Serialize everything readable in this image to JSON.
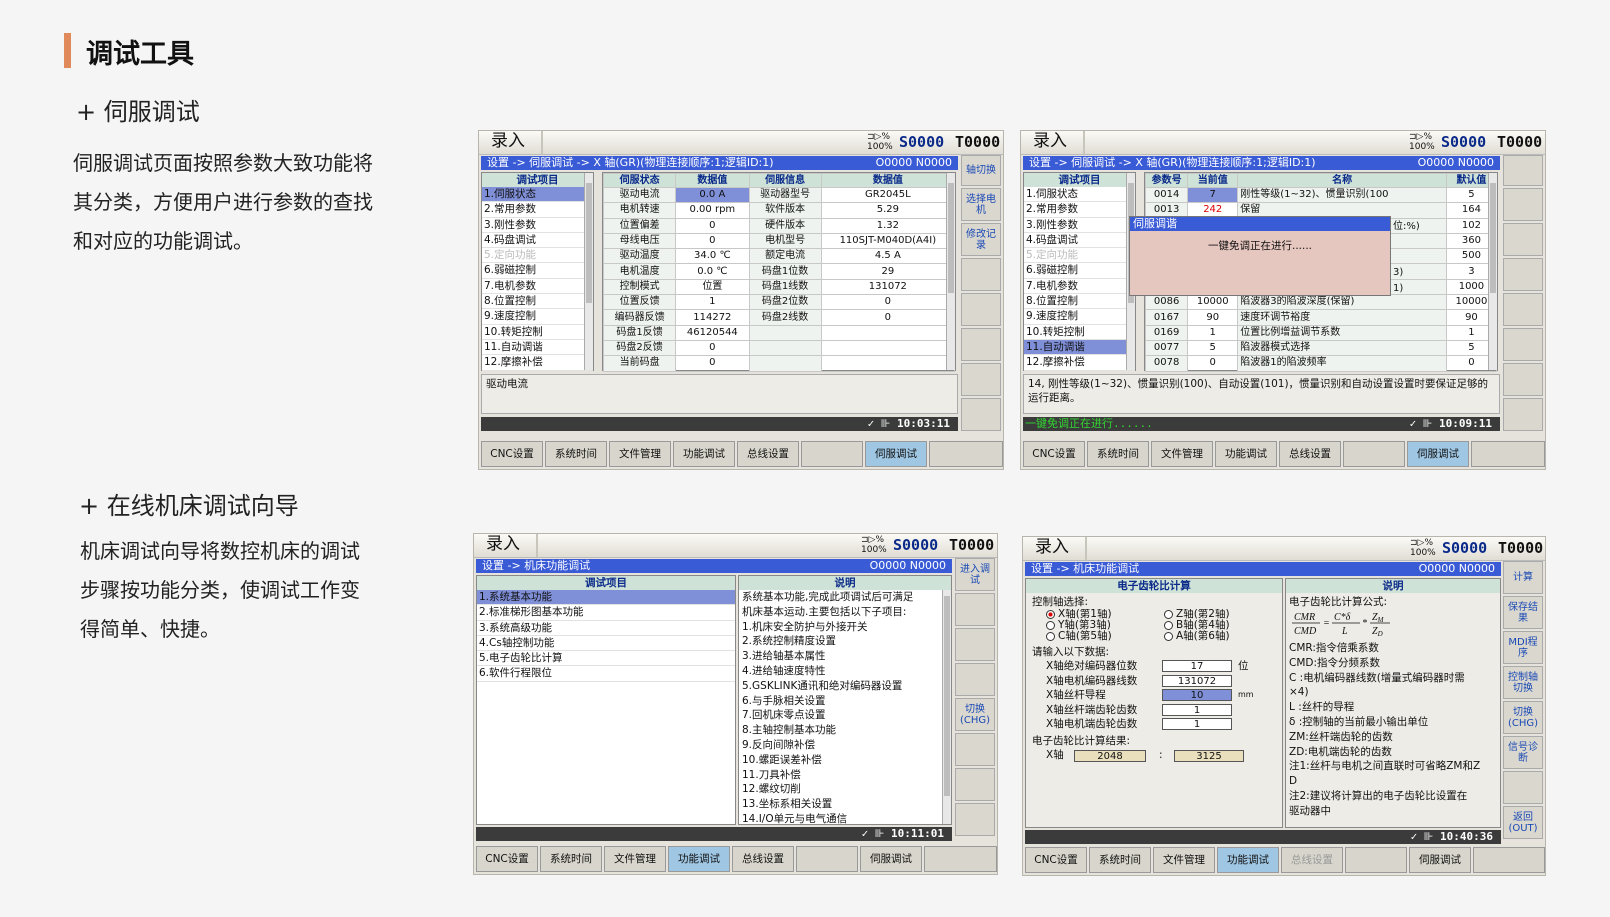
{
  "page": {
    "title": "调试工具",
    "section1": {
      "heading": "+ 伺服调试",
      "desc": [
        "伺服调试页面按照参数大致功能将",
        "其分类，方便用户进行参数的查找",
        "和对应的功能调试。"
      ]
    },
    "section2": {
      "heading": "+ 在线机床调试向导",
      "desc": [
        "机床调试向导将数控机床的调试",
        "步骤按功能分类，使调试工作变",
        "得简单、快捷。"
      ]
    }
  },
  "common": {
    "mode": "录入",
    "pct": "100%",
    "spindle": "S0000",
    "tool": "T0000",
    "status_code": "O0000 N0000",
    "bottom": [
      "CNC设置",
      "系统时间",
      "文件管理",
      "功能调试",
      "总线设置"
    ],
    "servo_btn": "伺服调试"
  },
  "s1": {
    "breadcrumb": "设置 -> 伺服调试 -> X 轴(GR)(物理连接顺序:1;逻辑ID:1)",
    "menu_header": "调试项目",
    "menu": [
      "1.伺服状态",
      "2.常用参数",
      "3.刚性参数",
      "4.码盘调试",
      "5.定向功能",
      "6.弱磁控制",
      "7.电机参数",
      "8.位置控制",
      "9.速度控制",
      "10.转矩控制",
      "11.自动调谐",
      "12.摩擦补偿"
    ],
    "cols": [
      "伺服状态",
      "数据值",
      "伺服信息",
      "数据值"
    ],
    "rows": [
      [
        "驱动电流",
        "0.0 A",
        "驱动器型号",
        "GR2045L"
      ],
      [
        "电机转速",
        "0.00 rpm",
        "软件版本",
        "5.29"
      ],
      [
        "位置偏差",
        "0",
        "硬件版本",
        "1.32"
      ],
      [
        "母线电压",
        "0",
        "电机型号",
        "110SJT-M040D(A4I)"
      ],
      [
        "驱动温度",
        "34.0 ℃",
        "额定电流",
        "4.5 A"
      ],
      [
        "电机温度",
        "0.0 ℃",
        "码盘1位数",
        "29"
      ],
      [
        "控制模式",
        "位置",
        "码盘1线数",
        "131072"
      ],
      [
        "位置反馈",
        "1",
        "码盘2位数",
        "0"
      ],
      [
        "编码器反馈",
        "114272",
        "码盘2线数",
        "0"
      ],
      [
        "码盘1反馈",
        "46120544",
        "",
        ""
      ],
      [
        "码盘2反馈",
        "0",
        "",
        ""
      ],
      [
        "当前码盘",
        "0",
        "",
        ""
      ]
    ],
    "message": "驱动电流",
    "time": "10:03:11",
    "side": [
      "轴切换",
      "选择电机",
      "修改记录"
    ]
  },
  "s2": {
    "breadcrumb": "设置 -> 伺服调试 -> X 轴(GR)(物理连接顺序:1;逻辑ID:1)",
    "cols": [
      "参数号",
      "当前值",
      "名称",
      "默认值"
    ],
    "rows": [
      [
        "0014",
        "7",
        "刚性等级(1~32)、惯量识别(100",
        "5"
      ],
      [
        "0013",
        "242",
        "保留",
        "164"
      ],
      [
        "",
        "",
        "",
        "102"
      ],
      [
        "",
        "",
        "",
        "360"
      ],
      [
        "",
        "",
        "",
        "500"
      ],
      [
        "",
        "",
        "",
        "3"
      ],
      [
        "",
        "",
        "",
        "1000"
      ],
      [
        "0086",
        "10000",
        "陷波器3的陷波深度(保留)",
        "10000"
      ],
      [
        "0167",
        "90",
        "速度环调节裕度",
        "90"
      ],
      [
        "0169",
        "1",
        "位置比例增益调节系数",
        "1"
      ],
      [
        "0077",
        "5",
        "陷波器模式选择",
        "5"
      ],
      [
        "0078",
        "0",
        "陷波器1的陷波频率",
        "0"
      ]
    ],
    "popup_title": "伺服调谐",
    "popup_text": "一键免调正在进行......",
    "peek": [
      "位:%)",
      "3)",
      "1)"
    ],
    "message": "14, 刚性等级(1~32)、惯量识别(100)、自动设置(101)，惯量识别和自动设置设置时要保证足够的运行距离。",
    "status_text": "一键免调正在进行......",
    "time": "10:09:11"
  },
  "s3": {
    "breadcrumb": "设置 -> 机床功能调试",
    "menu_header": "调试项目",
    "desc_header": "说明",
    "menu": [
      "1.系统基本功能",
      "2.标准梯形图基本功能",
      "3.系统高级功能",
      "4.Cs轴控制功能",
      "5.电子齿轮比计算",
      "6.软件行程限位"
    ],
    "desc": [
      "系统基本功能,完成此项调试后可满足",
      "机床基本运动.主要包括以下子项目:",
      "1.机床安全防护与外接开关",
      "2.系统控制精度设置",
      "3.进给轴基本属性",
      "4.进给轴速度特性",
      "5.GSKLINK通讯和绝对编码器设置",
      "6.与手脉相关设置",
      "7.回机床零点设置",
      "8.主轴控制基本功能",
      "9.反向间隙补偿",
      "10.螺距误差补偿",
      "11.刀具补偿",
      "12.螺纹切削",
      "13.坐标系相关设置",
      "14.I/O单元与电气通信"
    ],
    "time": "10:11:01",
    "side": [
      "进入调试",
      "切换(CHG)"
    ]
  },
  "s4": {
    "breadcrumb": "设置 -> 机床功能调试",
    "left_header": "电子齿轮比计算",
    "right_header": "说明",
    "axis_label": "控制轴选择:",
    "axes": [
      "X轴(第1轴)",
      "Z轴(第2轴)",
      "Y轴(第3轴)",
      "B轴(第4轴)",
      "C轴(第5轴)",
      "A轴(第6轴)"
    ],
    "input_label": "请输入以下数据:",
    "inputs": [
      {
        "label": "X轴绝对编码器位数",
        "value": "17",
        "unit": "位"
      },
      {
        "label": "X轴电机编码器线数",
        "value": "131072",
        "unit": ""
      },
      {
        "label": "X轴丝杆导程",
        "value": "10",
        "unit": "mm"
      },
      {
        "label": "X轴丝杆端齿轮齿数",
        "value": "1",
        "unit": ""
      },
      {
        "label": "X轴电机端齿轮齿数",
        "value": "1",
        "unit": ""
      }
    ],
    "result_label": "电子齿轮比计算结果:",
    "result_axis": "X轴",
    "cmr": "2048",
    "colon": ":",
    "cmd": "3125",
    "formula_title": "电子齿轮比计算公式:",
    "formula": {
      "cmr": "CMR",
      "cmd": "CMD",
      "c": "C",
      "delta": "δ",
      "l": "L",
      "zm": "Z",
      "zm_sub": "M",
      "zd": "Z",
      "zd_sub": "D",
      "eq": "=",
      "times": "*"
    },
    "notes": [
      "CMR:指令倍乘系数",
      "CMD:指令分频系数",
      "C :电机编码器线数(增量式编码器时需",
      "×4)",
      "L :丝杆的导程",
      "δ :控制轴的当前最小输出单位",
      "ZM:丝杆端齿轮的齿数",
      "ZD:电机端齿轮的齿数",
      "注1:丝杆与电机之间直联时可省略ZM和Z",
      "D",
      "注2:建议将计算出的电子齿轮比设置在",
      "驱动器中"
    ],
    "time": "10:40:36",
    "side": [
      "计算",
      "保存结果",
      "MDI程序",
      "控制轴切换",
      "切换(CHG)",
      "信号诊断",
      "",
      "返回(OUT)"
    ]
  }
}
